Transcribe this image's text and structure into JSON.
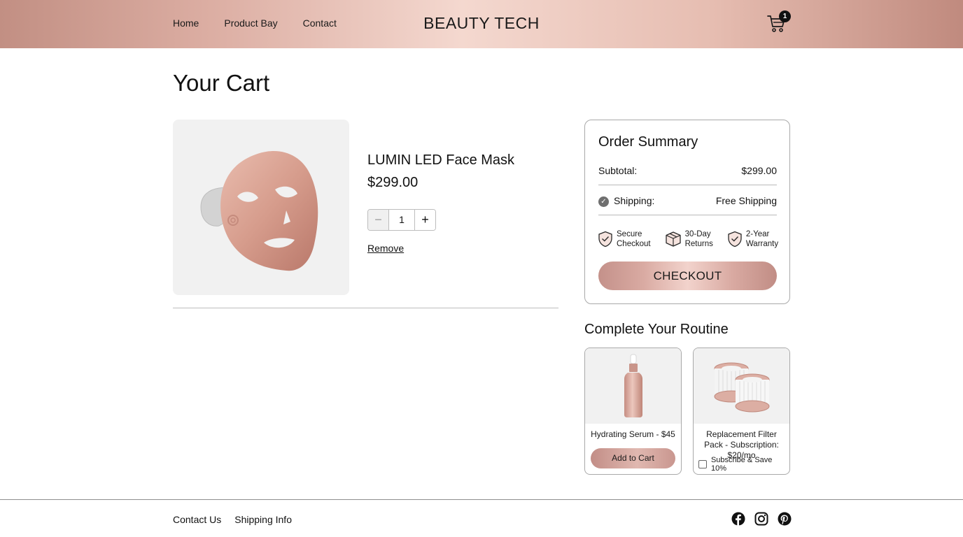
{
  "header": {
    "nav": [
      "Home",
      "Product Bay",
      "Contact"
    ],
    "brand": "BEAUTY TECH",
    "cart_count": "1"
  },
  "page_title": "Your Cart",
  "cart_item": {
    "name": "LUMIN LED Face Mask",
    "price": "$299.00",
    "quantity": "1",
    "remove_label": "Remove",
    "minus_label": "−",
    "plus_label": "+"
  },
  "summary": {
    "title": "Order Summary",
    "subtotal_label": "Subtotal:",
    "subtotal_value": "$299.00",
    "shipping_label": "Shipping:",
    "shipping_value": "Free Shipping",
    "badges": [
      "Secure\nCheckout",
      "30-Day\nReturns",
      "2-Year\nWarranty"
    ],
    "checkout_label": "CHECKOUT"
  },
  "routine": {
    "title": "Complete Your Routine",
    "items": [
      {
        "name": "Hydrating Serum - $45",
        "action": "Add to Cart"
      },
      {
        "name": "Replacement Filter Pack - Subscription: $20/mo",
        "action": "Subscribe & Save 10%"
      }
    ]
  },
  "footer": {
    "links": [
      "Contact Us",
      "Shipping Info"
    ],
    "socials": [
      "facebook-icon",
      "instagram-icon",
      "pinterest-icon"
    ]
  },
  "colors": {
    "rose_gold": "#d9aaa2",
    "rose_dark": "#c28f83",
    "light_bg": "#f1f1f1"
  }
}
